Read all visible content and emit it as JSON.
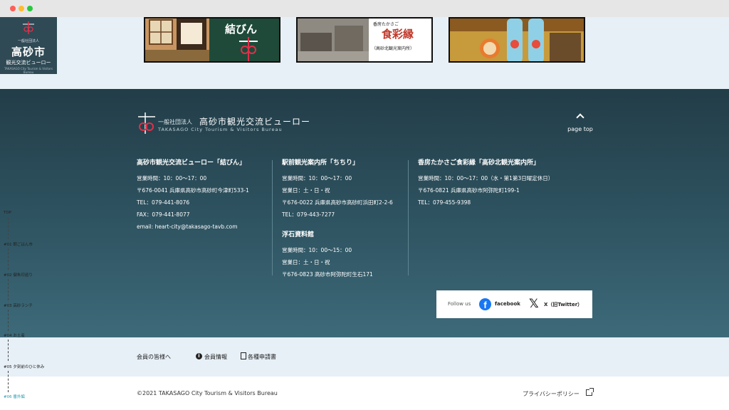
{
  "colors": {
    "footer_top": "#223d48",
    "footer_bottom": "#3d6a79",
    "light_band": "#e7f0f7",
    "side_logo_bg": "#2f4a55",
    "accent_active": "#2a9bb0",
    "facebook_blue": "#1877f2"
  },
  "window_controls": [
    "close",
    "minimize",
    "maximize"
  ],
  "thumbnails": [
    {
      "caption": "結びん"
    },
    {
      "caption_top": "香房たかさご",
      "caption_main": "食彩縁",
      "caption_sub": "（高砂北観光案内所）"
    },
    {
      "caption": ""
    }
  ],
  "side_logo": {
    "org": "一般社団法人",
    "city": "高砂市",
    "name": "観光交流ビューロー",
    "en": "TAKASAGO City Tourism & Visitors Bureau"
  },
  "brand": {
    "org_small": "一般社団法人",
    "org_big": "高砂市観光交流ビューロー",
    "org_en": "TAKASAGO City Tourism & Visitors Bureau"
  },
  "page_top": {
    "label": "page top",
    "icon": "chevron-up-icon"
  },
  "offices": {
    "musubin": {
      "title": "高砂市観光交流ビューロー「結びん」",
      "hours": "営業時間：10：00〜17：00",
      "address": "〒676-0041 兵庫県高砂市高砂町今津町533-1",
      "tel": "TEL：079-441-8076",
      "fax": "FAX：079-441-8077",
      "email": "email: heart-city@takasago-tavb.com"
    },
    "chichiri": {
      "title": "駅前観光案内所「ちちり」",
      "hours": "営業時間：10：00〜17：00",
      "days": "営業日：土・日・祝",
      "address": "〒676-0022 兵庫県高砂市高砂町浜田町2-2-6",
      "tel": "TEL：079-443-7277"
    },
    "ukiishi": {
      "title": "浮石資料館",
      "hours": "営業時間：10：00〜15：00",
      "days": "営業日：土・日・祝",
      "address": "〒676-0823 高砂市阿弥陀町生石171"
    },
    "kitakanko": {
      "title": "香房たかさご食彩縁「高砂北観光案内所」",
      "hours": "営業時間：10：00〜17：00（水・第1第3日曜定休日）",
      "address": "〒676-0821 兵庫県高砂市阿弥陀町199-1",
      "tel": "TEL：079-455-9398"
    }
  },
  "follow": {
    "label": "Follow us",
    "facebook": "facebook",
    "x": "X（旧Twitter）"
  },
  "member": {
    "title": "会員の皆様へ",
    "info": "会員情報",
    "applications": "各種申請書"
  },
  "bottom": {
    "copyright": "©2021 TAKASAGO City Tourism & Visitors Bureau",
    "privacy": "プライバシーポリシー"
  },
  "sidenav": [
    {
      "label": "TOP"
    },
    {
      "label": "#01 朝ごはん市"
    },
    {
      "label": "#02 御朱印巡り"
    },
    {
      "label": "#03 高砂ランチ"
    },
    {
      "label": "#04 お土産"
    },
    {
      "label": "#05 夕刻前のひと休み"
    },
    {
      "label": "#06 番外編",
      "active": true
    }
  ]
}
